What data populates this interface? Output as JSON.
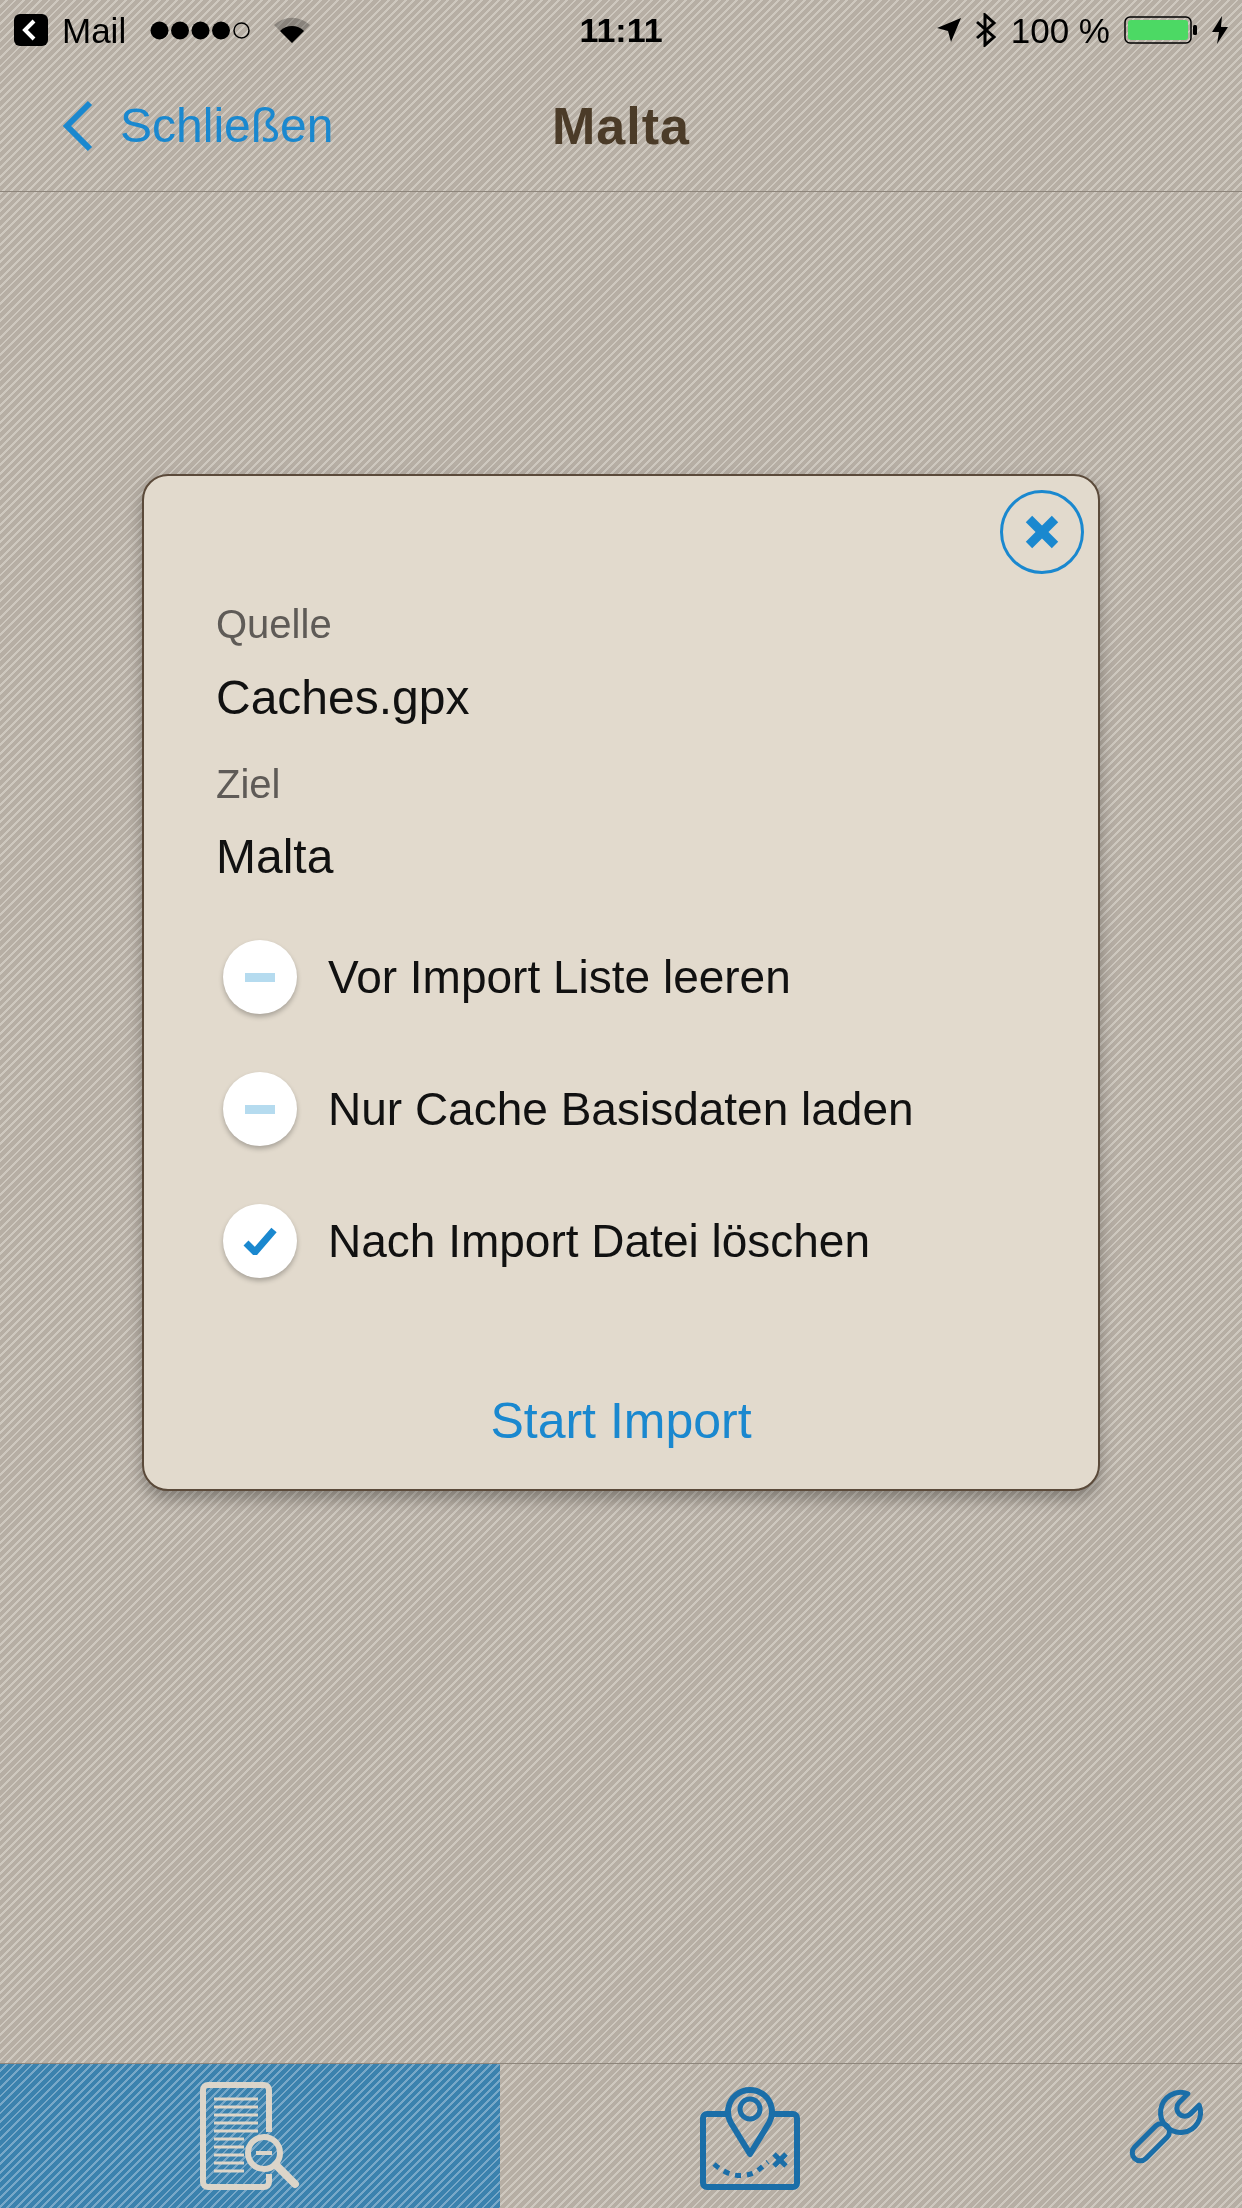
{
  "status_bar": {
    "back_app": "Mail",
    "time": "11:11",
    "battery": "100 %"
  },
  "nav_bar": {
    "back": "Schließen",
    "title": "Malta"
  },
  "dialog": {
    "fields": [
      {
        "label": "Quelle",
        "value": "Caches.gpx"
      },
      {
        "label": "Ziel",
        "value": "Malta"
      }
    ],
    "options": [
      {
        "label": "Vor Import Liste leeren",
        "checked": false
      },
      {
        "label": "Nur Cache Basisdaten laden",
        "checked": false
      },
      {
        "label": "Nach Import Datei löschen",
        "checked": true
      }
    ],
    "action": "Start Import"
  },
  "tab_bar": {
    "tabs": [
      {
        "kind": "documents",
        "selected": true
      },
      {
        "kind": "map",
        "selected": false
      },
      {
        "kind": "tools",
        "selected": false
      }
    ]
  }
}
